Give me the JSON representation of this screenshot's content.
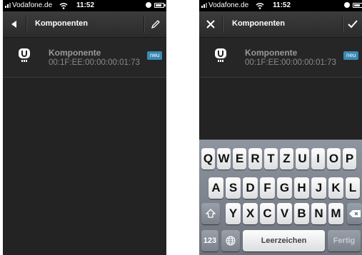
{
  "left": {
    "status": {
      "carrier": "Vodafone.de",
      "time": "11:52"
    },
    "nav": {
      "title": "Komponenten",
      "left_icon": "back-arrow-icon",
      "right_icon": "pencil-icon"
    },
    "row": {
      "name": "Komponente",
      "mac": "00:1F:EE:00:00:00:01:73",
      "badge": "neu"
    }
  },
  "right": {
    "status": {
      "carrier": "Vodafone.de",
      "time": "11:52"
    },
    "nav": {
      "title": "Komponenten",
      "left_icon": "close-icon",
      "right_icon": "checkmark-icon"
    },
    "row": {
      "name": "Komponente",
      "mac": "00:1F:EE:00:00:00:01:73",
      "badge": "neu"
    },
    "keyboard": {
      "row1": [
        "Q",
        "W",
        "E",
        "R",
        "T",
        "Z",
        "U",
        "I",
        "O",
        "P"
      ],
      "row2": [
        "A",
        "S",
        "D",
        "F",
        "G",
        "H",
        "J",
        "K",
        "L"
      ],
      "row3": [
        "Y",
        "X",
        "C",
        "V",
        "B",
        "N",
        "M"
      ],
      "numbers_key": "123",
      "space_key": "Leerzeichen",
      "done_key": "Fertig",
      "shift_icon": "shift-arrow-icon",
      "backspace_icon": "backspace-icon",
      "globe_icon": "globe-icon"
    }
  },
  "colors": {
    "accent_badge": "#3a89b4",
    "background": "#232323",
    "navbar": "#333333"
  }
}
